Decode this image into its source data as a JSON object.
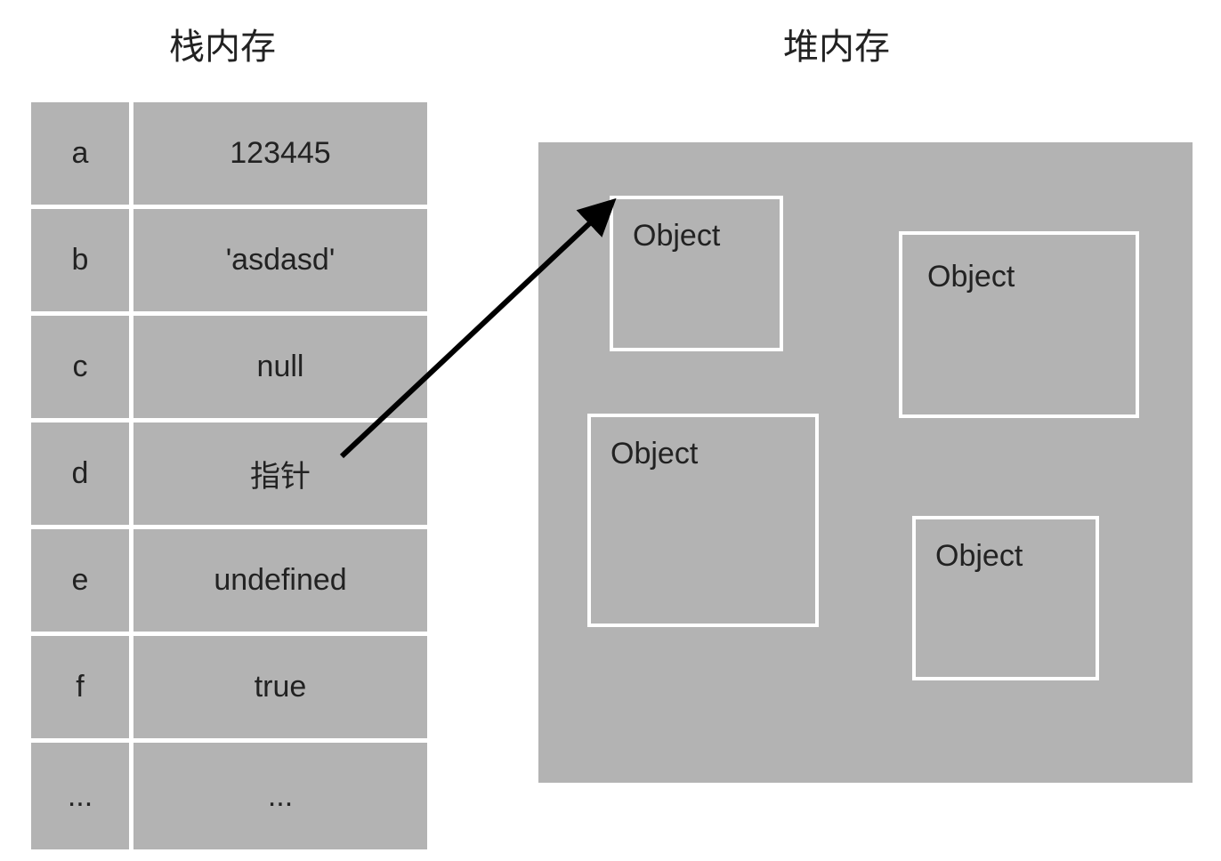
{
  "headers": {
    "stack": "栈内存",
    "heap": "堆内存"
  },
  "stack": [
    {
      "key": "a",
      "value": "123445"
    },
    {
      "key": "b",
      "value": "'asdasd'"
    },
    {
      "key": "c",
      "value": "null"
    },
    {
      "key": "d",
      "value": "指针"
    },
    {
      "key": "e",
      "value": "undefined"
    },
    {
      "key": "f",
      "value": "true"
    },
    {
      "key": "...",
      "value": "..."
    }
  ],
  "heap": {
    "obj1": "Object",
    "obj2": "Object",
    "obj3": "Object",
    "obj4": "Object"
  }
}
